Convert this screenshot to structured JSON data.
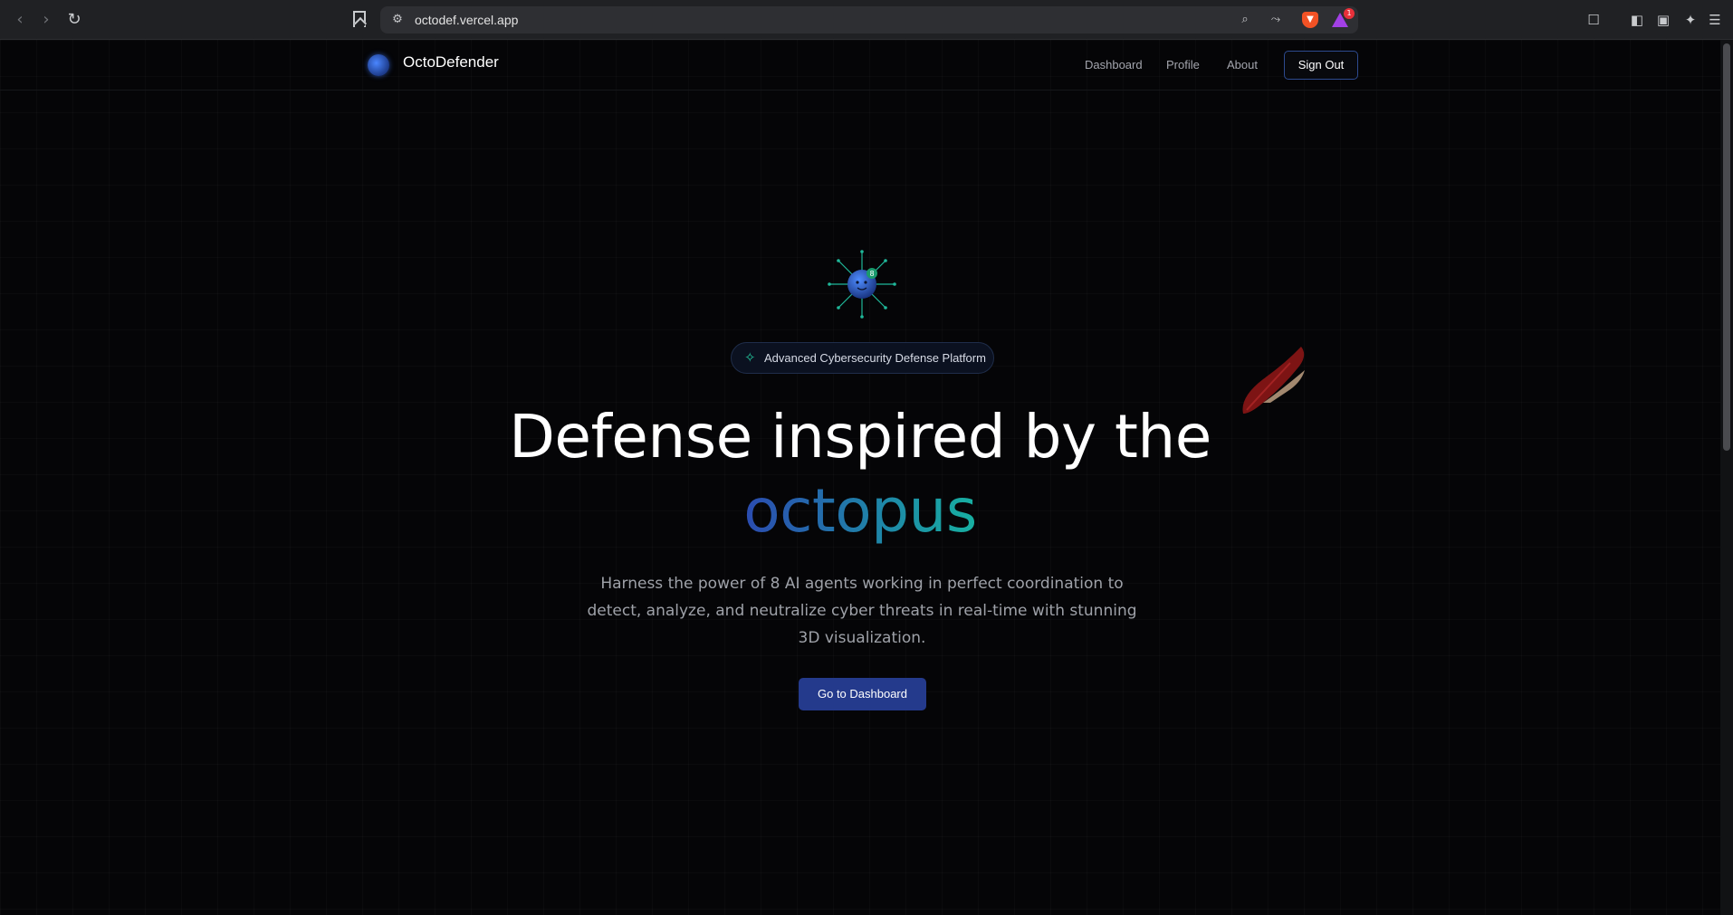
{
  "browser": {
    "url": "octodef.vercel.app",
    "rewards_count": "1"
  },
  "nav": {
    "brand": "OctoDefender",
    "links": [
      "Dashboard",
      "Profile",
      "About"
    ],
    "sign_out": "Sign Out"
  },
  "hero": {
    "badge": "Advanced Cybersecurity Defense Platform",
    "title_line1": "Defense inspired by the",
    "title_line2": "octopus",
    "subtitle": "Harness the power of 8 AI agents working in perfect coordination to detect, analyze, and neutralize cyber threats in real-time with stunning 3D visualization.",
    "cta": "Go to Dashboard",
    "octo_badge": "8"
  },
  "colors": {
    "accent": "#243a8c",
    "gradient_start": "#2b4bb0",
    "gradient_end": "#17b0a1",
    "badge_icon": "#22c39a"
  }
}
